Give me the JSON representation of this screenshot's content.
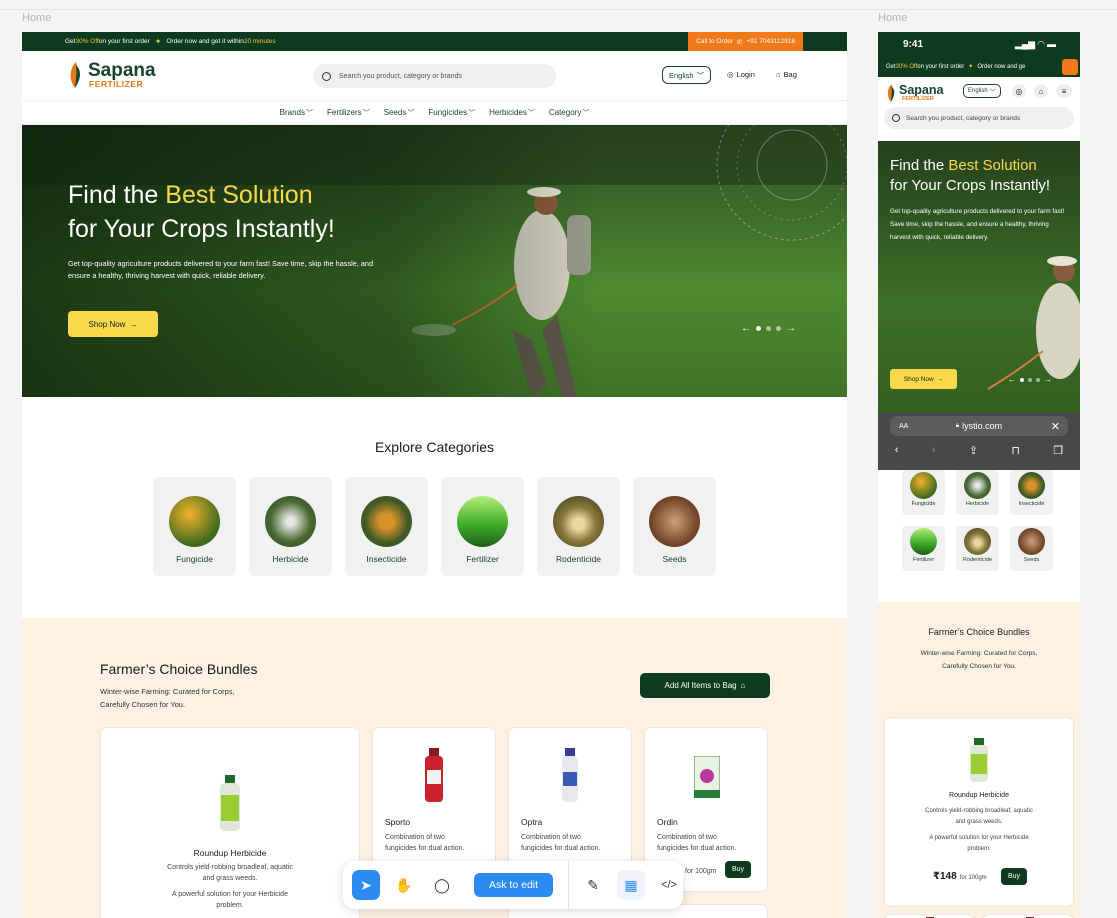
{
  "canvas": {
    "desktop_label": "Home",
    "mobile_label": "Home"
  },
  "promo": {
    "prefix": "Get ",
    "discount": "30% Off",
    "suffix": " on your first order",
    "order_text": "Order now and get it within ",
    "order_time": "20 minutes",
    "call_label": "Call to Order",
    "phone": "+91 7043112918"
  },
  "brand": {
    "name": "Sapana",
    "sub": "FERTILIZER",
    "leaf_color": "#e8781a",
    "primary_color": "#0e3b20",
    "accent_color": "#f8d94a"
  },
  "header": {
    "search_placeholder": "Search you product, category or brands",
    "language": "English",
    "login": "Login",
    "bag": "Bag"
  },
  "nav": [
    "Brands",
    "Fertilizers",
    "Seeds",
    "Fungicides",
    "Herbicides",
    "Category"
  ],
  "hero": {
    "title_pre": "Find the ",
    "title_highlight": "Best Solution",
    "title_line2": "for Your Crops Instantly!",
    "description": "Get top-quality agriculture products delivered to your farm fast! Save time, skip the hassle, and ensure a healthy, thriving harvest with quick, reliable delivery.",
    "cta": "Shop Now",
    "slides": 3,
    "active_slide": 1
  },
  "explore": {
    "title": "Explore Categories",
    "categories": [
      "Fungicide",
      "Herbicide",
      "Insecticide",
      "Fertilizer",
      "Rodenticide",
      "Seeds"
    ]
  },
  "bundles": {
    "title": "Farmer’s Choice Bundles",
    "desc_line1": "Winter-wise Farming: Curated for Corps,",
    "desc_line2": "Carefully Chosen for You.",
    "add_all": "Add All Items to Bag",
    "featured": {
      "name": "Roundup Herbicide",
      "desc1": "Controls yield-robbing broadleaf, aquatic",
      "desc2": "and grass weeds.",
      "desc3": "A powerful solution for your Herbicide",
      "desc4": "problem.",
      "price": "₹148",
      "unit": "for 100gm",
      "buy": "Buy"
    },
    "products": [
      {
        "name": "Sporto",
        "desc1": "Combination of two",
        "desc2": "fungicides for dual action."
      },
      {
        "name": "Optra",
        "desc1": "Combination of two",
        "desc2": "fungicides for dual action."
      },
      {
        "name": "Ordin",
        "desc1": "Combination of two",
        "desc2": "fungicides for dual action.",
        "unit": "for 100gm",
        "buy": "Buy"
      }
    ]
  },
  "toolbar": {
    "ask": "Ask to edit"
  },
  "mobile": {
    "time": "9:41",
    "promo_order": "Order now and ge",
    "browser_url": "lystio.com",
    "browser_aa": "AA"
  }
}
